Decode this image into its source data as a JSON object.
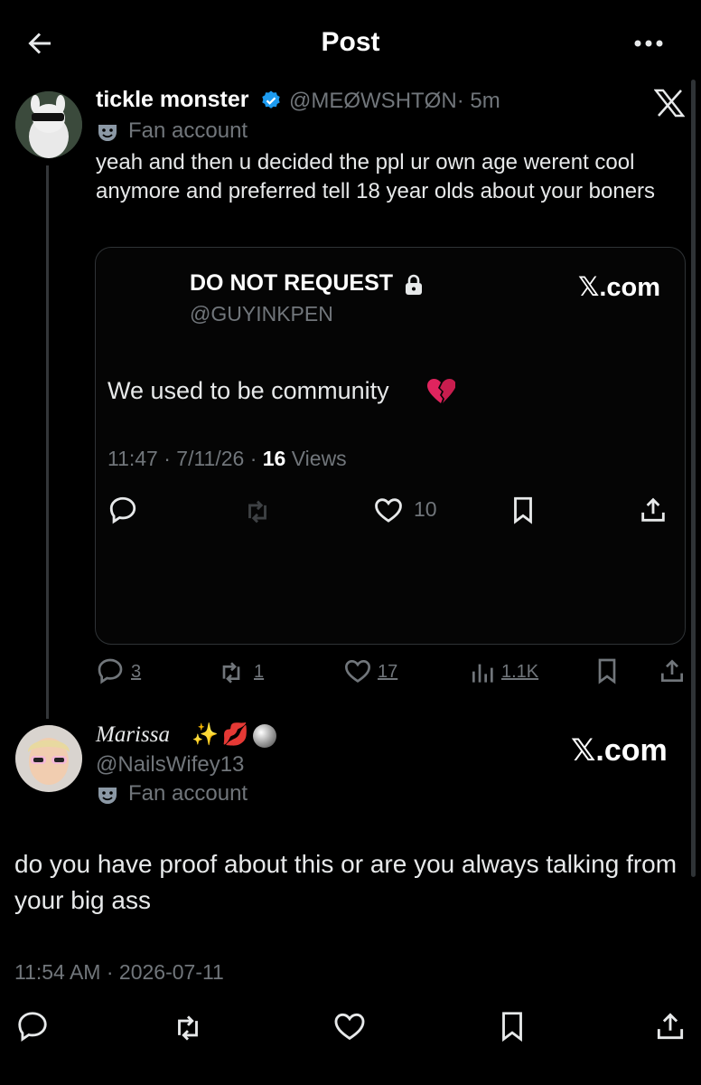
{
  "header": {
    "title": "Post",
    "back_icon": "arrow-left-icon",
    "more_icon": "more-horizontal-icon"
  },
  "tweet": {
    "author_name": "tickle monster",
    "handle": "@MEØWSHTØN",
    "time": "· 5m",
    "label": "Fan account",
    "text": "yeah and then u decided the ppl ur own age werent cool anymore and preferred tell 18 year olds about your boners",
    "quote": {
      "author_name": "DO NOT REQUEST",
      "handle": "@GUYINKPEN",
      "source": "𝕏.com",
      "text": "We used to be community",
      "meta_prefix": "11:47 · 7/11/26 · ",
      "views_count": "16",
      "views_label": " Views",
      "like_count": "10"
    },
    "actions": {
      "replies": "3",
      "reposts": "1",
      "likes": "17",
      "views": "1.1K"
    }
  },
  "reply": {
    "author_name": "Marissa",
    "emojis": [
      "✨",
      "💋"
    ],
    "handle": "@NailsWifey13",
    "source": "𝕏.com",
    "label": "Fan account",
    "text": "do you have proof about this or are you always talking from your big ass",
    "meta": "11:54 AM · 2026-07-11"
  },
  "colors": {
    "background": "#000000",
    "text": "#e7e9ea",
    "muted": "#71767b",
    "verified": "#1d9bf0",
    "border": "#2f3336"
  }
}
